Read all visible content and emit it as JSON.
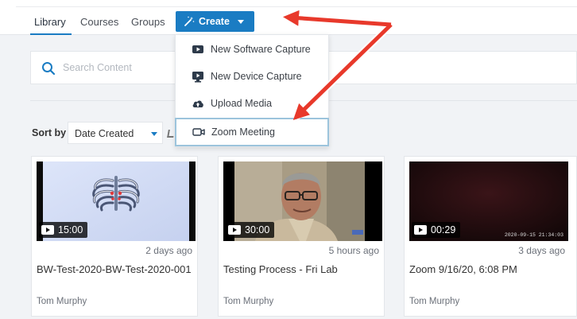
{
  "nav": {
    "tabs": [
      {
        "label": "Library",
        "active": true
      },
      {
        "label": "Courses",
        "active": false
      },
      {
        "label": "Groups",
        "active": false
      }
    ],
    "create_label": "Create"
  },
  "create_menu": {
    "items": [
      {
        "label": "New Software Capture",
        "icon": "screen-capture-icon"
      },
      {
        "label": "New Device Capture",
        "icon": "device-capture-icon"
      },
      {
        "label": "Upload Media",
        "icon": "cloud-upload-icon"
      },
      {
        "label": "Zoom Meeting",
        "icon": "zoom-camera-icon",
        "highlighted": true
      }
    ]
  },
  "search": {
    "placeholder": "Search Content",
    "value": ""
  },
  "sort": {
    "label": "Sort by",
    "selected": "Date Created"
  },
  "cards": [
    {
      "duration": "15:00",
      "age": "2 days ago",
      "title": "BW-Test-2020-BW-Test-2020-001",
      "owner": "Tom Murphy",
      "thumbnail": "ribcage-illustration"
    },
    {
      "duration": "30:00",
      "age": "5 hours ago",
      "title": "Testing Process - Fri Lab",
      "owner": "Tom Murphy",
      "thumbnail": "man-with-glasses-photo"
    },
    {
      "duration": "00:29",
      "age": "3 days ago",
      "title": "Zoom 9/16/20, 6:08 PM",
      "owner": "Tom Murphy",
      "thumbnail": "dark-video-frame",
      "stamp": "2020-09-15 21:34:03"
    }
  ],
  "colors": {
    "accent": "#1a7cc3",
    "annotation_arrow": "#e8392b",
    "highlight_border": "#9cc4dc"
  }
}
